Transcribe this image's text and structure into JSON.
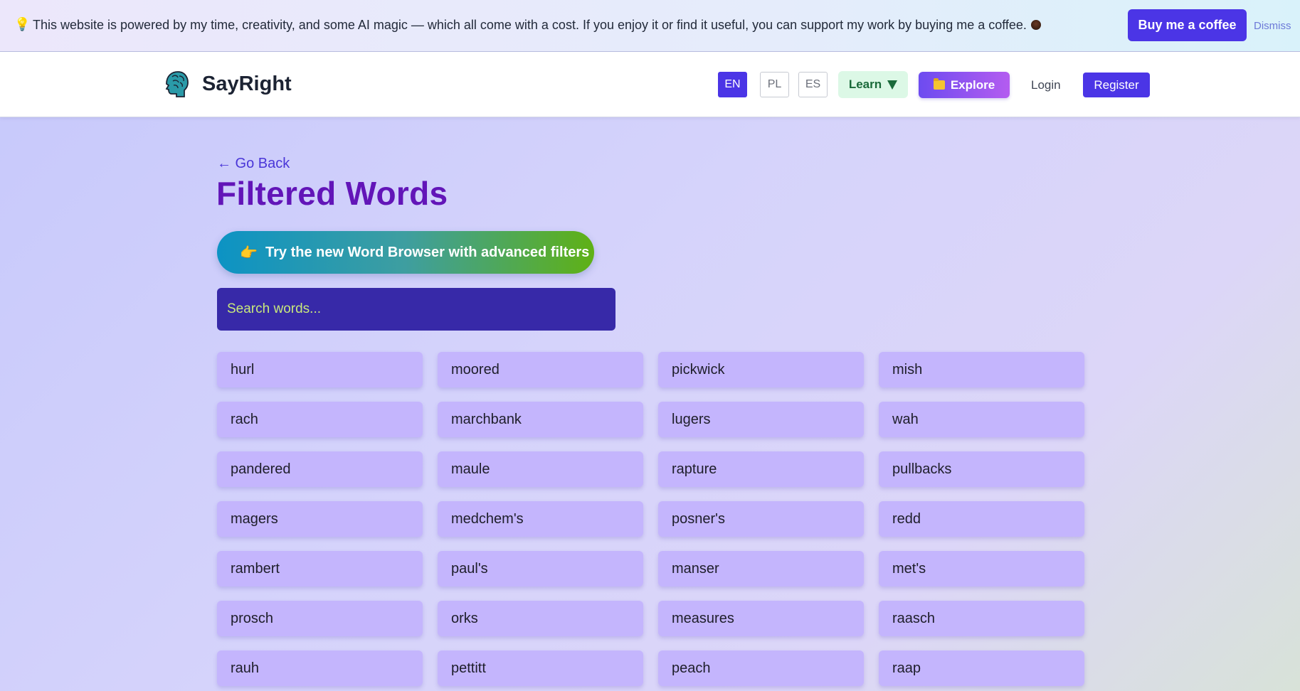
{
  "banner": {
    "icon": "lightbulb-icon",
    "text": "This website is powered by my time, creativity, and some AI magic — which all come with a cost. If you enjoy it or find it useful, you can support my work by buying me a coffee.",
    "coffee_icon": "coffee-cup-icon",
    "buy_label": "Buy me a coffee",
    "dismiss_label": "Dismiss",
    "button_color": "#4b35e6"
  },
  "header": {
    "logo_icon": "brain-head-icon",
    "brand": "SayRight",
    "languages": [
      "EN",
      "PL",
      "ES"
    ],
    "active_language": "EN",
    "learn_label": "Learn",
    "explore_label": "Explore",
    "explore_icon": "folder-icon",
    "login_label": "Login",
    "register_label": "Register"
  },
  "main": {
    "back_label": "← Go Back",
    "title": "Filtered Words",
    "try_label": "Try the new Word Browser with advanced filters",
    "try_icon": "pointing-hand-icon",
    "search_placeholder": "Search words...",
    "title_color": "#6215b8",
    "card_color": "#c4b5fd",
    "words": [
      "hurl",
      "moored",
      "pickwick",
      "mish",
      "rach",
      "marchbank",
      "lugers",
      "wah",
      "pandered",
      "maule",
      "rapture",
      "pullbacks",
      "magers",
      "medchem's",
      "posner's",
      "redd",
      "rambert",
      "paul's",
      "manser",
      "met's",
      "prosch",
      "orks",
      "measures",
      "raasch",
      "rauh",
      "pettitt",
      "peach",
      "raap"
    ]
  }
}
